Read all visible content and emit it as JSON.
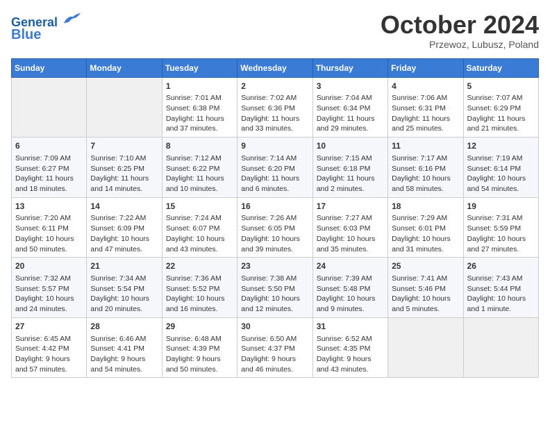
{
  "header": {
    "logo_line1": "General",
    "logo_line2": "Blue",
    "month": "October 2024",
    "location": "Przewoz, Lubusz, Poland"
  },
  "days_of_week": [
    "Sunday",
    "Monday",
    "Tuesday",
    "Wednesday",
    "Thursday",
    "Friday",
    "Saturday"
  ],
  "weeks": [
    [
      {
        "day": "",
        "empty": true
      },
      {
        "day": "",
        "empty": true
      },
      {
        "day": "1",
        "sunrise": "Sunrise: 7:01 AM",
        "sunset": "Sunset: 6:38 PM",
        "daylight": "Daylight: 11 hours and 37 minutes."
      },
      {
        "day": "2",
        "sunrise": "Sunrise: 7:02 AM",
        "sunset": "Sunset: 6:36 PM",
        "daylight": "Daylight: 11 hours and 33 minutes."
      },
      {
        "day": "3",
        "sunrise": "Sunrise: 7:04 AM",
        "sunset": "Sunset: 6:34 PM",
        "daylight": "Daylight: 11 hours and 29 minutes."
      },
      {
        "day": "4",
        "sunrise": "Sunrise: 7:06 AM",
        "sunset": "Sunset: 6:31 PM",
        "daylight": "Daylight: 11 hours and 25 minutes."
      },
      {
        "day": "5",
        "sunrise": "Sunrise: 7:07 AM",
        "sunset": "Sunset: 6:29 PM",
        "daylight": "Daylight: 11 hours and 21 minutes."
      }
    ],
    [
      {
        "day": "6",
        "sunrise": "Sunrise: 7:09 AM",
        "sunset": "Sunset: 6:27 PM",
        "daylight": "Daylight: 11 hours and 18 minutes."
      },
      {
        "day": "7",
        "sunrise": "Sunrise: 7:10 AM",
        "sunset": "Sunset: 6:25 PM",
        "daylight": "Daylight: 11 hours and 14 minutes."
      },
      {
        "day": "8",
        "sunrise": "Sunrise: 7:12 AM",
        "sunset": "Sunset: 6:22 PM",
        "daylight": "Daylight: 11 hours and 10 minutes."
      },
      {
        "day": "9",
        "sunrise": "Sunrise: 7:14 AM",
        "sunset": "Sunset: 6:20 PM",
        "daylight": "Daylight: 11 hours and 6 minutes."
      },
      {
        "day": "10",
        "sunrise": "Sunrise: 7:15 AM",
        "sunset": "Sunset: 6:18 PM",
        "daylight": "Daylight: 11 hours and 2 minutes."
      },
      {
        "day": "11",
        "sunrise": "Sunrise: 7:17 AM",
        "sunset": "Sunset: 6:16 PM",
        "daylight": "Daylight: 10 hours and 58 minutes."
      },
      {
        "day": "12",
        "sunrise": "Sunrise: 7:19 AM",
        "sunset": "Sunset: 6:14 PM",
        "daylight": "Daylight: 10 hours and 54 minutes."
      }
    ],
    [
      {
        "day": "13",
        "sunrise": "Sunrise: 7:20 AM",
        "sunset": "Sunset: 6:11 PM",
        "daylight": "Daylight: 10 hours and 50 minutes."
      },
      {
        "day": "14",
        "sunrise": "Sunrise: 7:22 AM",
        "sunset": "Sunset: 6:09 PM",
        "daylight": "Daylight: 10 hours and 47 minutes."
      },
      {
        "day": "15",
        "sunrise": "Sunrise: 7:24 AM",
        "sunset": "Sunset: 6:07 PM",
        "daylight": "Daylight: 10 hours and 43 minutes."
      },
      {
        "day": "16",
        "sunrise": "Sunrise: 7:26 AM",
        "sunset": "Sunset: 6:05 PM",
        "daylight": "Daylight: 10 hours and 39 minutes."
      },
      {
        "day": "17",
        "sunrise": "Sunrise: 7:27 AM",
        "sunset": "Sunset: 6:03 PM",
        "daylight": "Daylight: 10 hours and 35 minutes."
      },
      {
        "day": "18",
        "sunrise": "Sunrise: 7:29 AM",
        "sunset": "Sunset: 6:01 PM",
        "daylight": "Daylight: 10 hours and 31 minutes."
      },
      {
        "day": "19",
        "sunrise": "Sunrise: 7:31 AM",
        "sunset": "Sunset: 5:59 PM",
        "daylight": "Daylight: 10 hours and 27 minutes."
      }
    ],
    [
      {
        "day": "20",
        "sunrise": "Sunrise: 7:32 AM",
        "sunset": "Sunset: 5:57 PM",
        "daylight": "Daylight: 10 hours and 24 minutes."
      },
      {
        "day": "21",
        "sunrise": "Sunrise: 7:34 AM",
        "sunset": "Sunset: 5:54 PM",
        "daylight": "Daylight: 10 hours and 20 minutes."
      },
      {
        "day": "22",
        "sunrise": "Sunrise: 7:36 AM",
        "sunset": "Sunset: 5:52 PM",
        "daylight": "Daylight: 10 hours and 16 minutes."
      },
      {
        "day": "23",
        "sunrise": "Sunrise: 7:38 AM",
        "sunset": "Sunset: 5:50 PM",
        "daylight": "Daylight: 10 hours and 12 minutes."
      },
      {
        "day": "24",
        "sunrise": "Sunrise: 7:39 AM",
        "sunset": "Sunset: 5:48 PM",
        "daylight": "Daylight: 10 hours and 9 minutes."
      },
      {
        "day": "25",
        "sunrise": "Sunrise: 7:41 AM",
        "sunset": "Sunset: 5:46 PM",
        "daylight": "Daylight: 10 hours and 5 minutes."
      },
      {
        "day": "26",
        "sunrise": "Sunrise: 7:43 AM",
        "sunset": "Sunset: 5:44 PM",
        "daylight": "Daylight: 10 hours and 1 minute."
      }
    ],
    [
      {
        "day": "27",
        "sunrise": "Sunrise: 6:45 AM",
        "sunset": "Sunset: 4:42 PM",
        "daylight": "Daylight: 9 hours and 57 minutes."
      },
      {
        "day": "28",
        "sunrise": "Sunrise: 6:46 AM",
        "sunset": "Sunset: 4:41 PM",
        "daylight": "Daylight: 9 hours and 54 minutes."
      },
      {
        "day": "29",
        "sunrise": "Sunrise: 6:48 AM",
        "sunset": "Sunset: 4:39 PM",
        "daylight": "Daylight: 9 hours and 50 minutes."
      },
      {
        "day": "30",
        "sunrise": "Sunrise: 6:50 AM",
        "sunset": "Sunset: 4:37 PM",
        "daylight": "Daylight: 9 hours and 46 minutes."
      },
      {
        "day": "31",
        "sunrise": "Sunrise: 6:52 AM",
        "sunset": "Sunset: 4:35 PM",
        "daylight": "Daylight: 9 hours and 43 minutes."
      },
      {
        "day": "",
        "empty": true
      },
      {
        "day": "",
        "empty": true
      }
    ]
  ]
}
